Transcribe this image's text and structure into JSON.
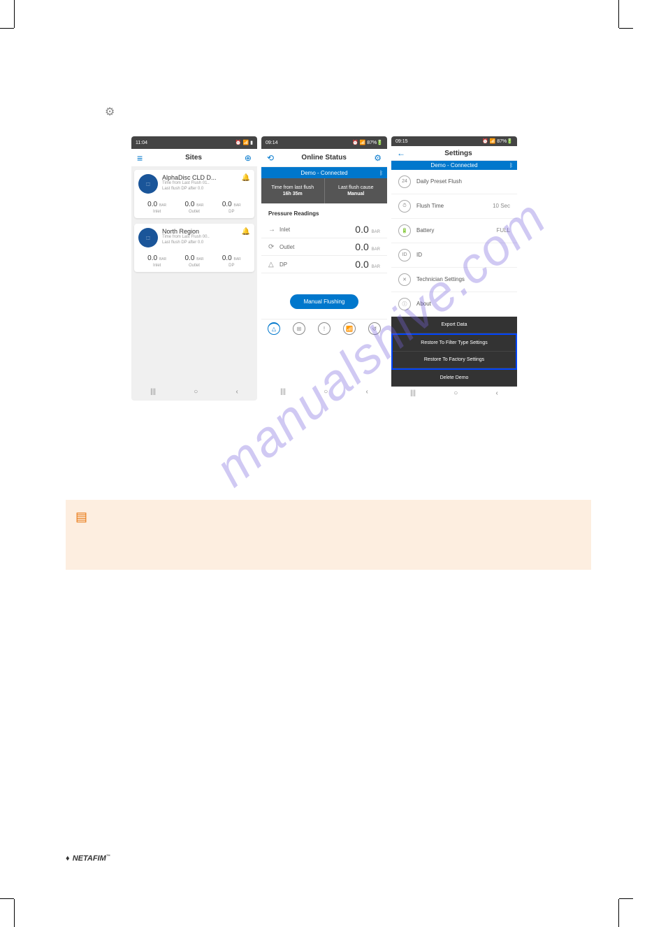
{
  "phone1": {
    "status_time": "11:04",
    "status_right": "⏰ 📶 ▮",
    "header_title": "Sites",
    "sites": [
      {
        "name": "AlphaDisc CLD D...",
        "meta1": "Time from Last Flush 01..",
        "meta2": "Last flush DP after 0.0",
        "inlet": "0.0",
        "outlet": "0.0",
        "dp": "0.0"
      },
      {
        "name": "North Region",
        "meta1": "Time from Last Flush 00..",
        "meta2": "Last flush DP after 0.0",
        "inlet": "0.0",
        "outlet": "0.0",
        "dp": "0.0"
      }
    ],
    "unit": "BAR",
    "labels": {
      "inlet": "Inlet",
      "outlet": "Outlet",
      "dp": "DP"
    }
  },
  "phone2": {
    "status_time": "09:14",
    "status_right": "⏰ 📶 87%🔋",
    "header_title": "Online Status",
    "demo_bar": "Demo - Connected",
    "info": {
      "left_label": "Time from last flush",
      "left_val": "16h 35m",
      "right_label": "Last flush cause",
      "right_val": "Manual"
    },
    "section": "Pressure Readings",
    "readings": [
      {
        "icon": "→",
        "label": "Inlet",
        "val": "0.0",
        "unit": "BAR"
      },
      {
        "icon": "⟳",
        "label": "Outlet",
        "val": "0.0",
        "unit": "BAR"
      },
      {
        "icon": "△",
        "label": "DP",
        "val": "0.0",
        "unit": "BAR"
      }
    ],
    "button": "Manual Flushing"
  },
  "phone3": {
    "status_time": "09:15",
    "status_right": "⏰ 📶 87%🔋",
    "header_title": "Settings",
    "demo_bar": "Demo - Connected",
    "rows": [
      {
        "icon": "24",
        "label": "Daily Preset Flush",
        "value": ""
      },
      {
        "icon": "⏱",
        "label": "Flush Time",
        "value": "10 Sec"
      },
      {
        "icon": "🔋",
        "label": "Battery",
        "value": "FULL"
      },
      {
        "icon": "ID",
        "label": "ID",
        "value": ""
      },
      {
        "icon": "✕",
        "label": "Technician Settings",
        "value": ""
      },
      {
        "icon": "ⓘ",
        "label": "About",
        "value": ""
      }
    ],
    "actions": {
      "export": "Export Data",
      "restore_type": "Restore To Filter Type Settings",
      "restore_factory": "Restore To Factory Settings",
      "delete": "Delete Demo"
    }
  },
  "watermark": "manualshive.com",
  "footer_brand": "NETAFIM"
}
